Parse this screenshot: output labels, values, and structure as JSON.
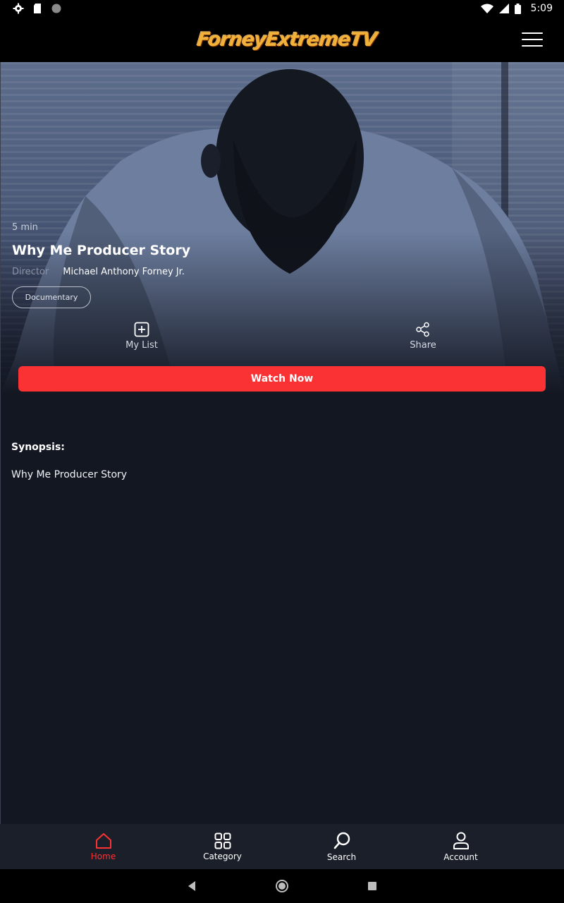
{
  "status_bar": {
    "time": "5:09",
    "left_icons": [
      "settings-icon",
      "sd-card-icon",
      "record-icon"
    ],
    "right_icons": [
      "wifi-icon",
      "signal-icon",
      "battery-icon"
    ]
  },
  "header": {
    "logo_text": "ForneyExtremeTV",
    "menu_icon": "hamburger-icon"
  },
  "content": {
    "duration": "5 min",
    "title": "Why Me Producer Story",
    "director_label": "Director",
    "director_name": "Michael Anthony Forney Jr.",
    "genre": "Documentary",
    "actions": {
      "my_list": "My List",
      "share": "Share"
    },
    "watch_now": "Watch Now",
    "synopsis_label": "Synopsis:",
    "synopsis_text": "Why Me Producer Story"
  },
  "bottom_nav": {
    "active": "Home",
    "items": [
      {
        "label": "Home",
        "icon": "home-icon"
      },
      {
        "label": "Category",
        "icon": "grid-icon"
      },
      {
        "label": "Search",
        "icon": "search-icon"
      },
      {
        "label": "Account",
        "icon": "user-icon"
      }
    ]
  },
  "colors": {
    "accent": "#fb3233",
    "background": "#131722",
    "nav_background": "#1b1f2a"
  }
}
